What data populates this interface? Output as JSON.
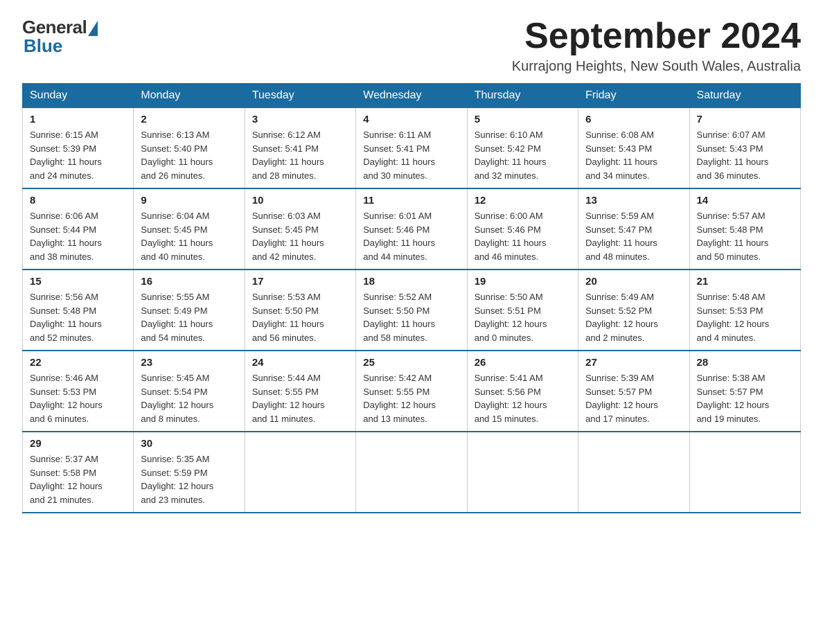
{
  "logo": {
    "general": "General",
    "blue": "Blue"
  },
  "title": "September 2024",
  "subtitle": "Kurrajong Heights, New South Wales, Australia",
  "days_of_week": [
    "Sunday",
    "Monday",
    "Tuesday",
    "Wednesday",
    "Thursday",
    "Friday",
    "Saturday"
  ],
  "weeks": [
    [
      {
        "day": "1",
        "sunrise": "6:15 AM",
        "sunset": "5:39 PM",
        "daylight": "11 hours and 24 minutes."
      },
      {
        "day": "2",
        "sunrise": "6:13 AM",
        "sunset": "5:40 PM",
        "daylight": "11 hours and 26 minutes."
      },
      {
        "day": "3",
        "sunrise": "6:12 AM",
        "sunset": "5:41 PM",
        "daylight": "11 hours and 28 minutes."
      },
      {
        "day": "4",
        "sunrise": "6:11 AM",
        "sunset": "5:41 PM",
        "daylight": "11 hours and 30 minutes."
      },
      {
        "day": "5",
        "sunrise": "6:10 AM",
        "sunset": "5:42 PM",
        "daylight": "11 hours and 32 minutes."
      },
      {
        "day": "6",
        "sunrise": "6:08 AM",
        "sunset": "5:43 PM",
        "daylight": "11 hours and 34 minutes."
      },
      {
        "day": "7",
        "sunrise": "6:07 AM",
        "sunset": "5:43 PM",
        "daylight": "11 hours and 36 minutes."
      }
    ],
    [
      {
        "day": "8",
        "sunrise": "6:06 AM",
        "sunset": "5:44 PM",
        "daylight": "11 hours and 38 minutes."
      },
      {
        "day": "9",
        "sunrise": "6:04 AM",
        "sunset": "5:45 PM",
        "daylight": "11 hours and 40 minutes."
      },
      {
        "day": "10",
        "sunrise": "6:03 AM",
        "sunset": "5:45 PM",
        "daylight": "11 hours and 42 minutes."
      },
      {
        "day": "11",
        "sunrise": "6:01 AM",
        "sunset": "5:46 PM",
        "daylight": "11 hours and 44 minutes."
      },
      {
        "day": "12",
        "sunrise": "6:00 AM",
        "sunset": "5:46 PM",
        "daylight": "11 hours and 46 minutes."
      },
      {
        "day": "13",
        "sunrise": "5:59 AM",
        "sunset": "5:47 PM",
        "daylight": "11 hours and 48 minutes."
      },
      {
        "day": "14",
        "sunrise": "5:57 AM",
        "sunset": "5:48 PM",
        "daylight": "11 hours and 50 minutes."
      }
    ],
    [
      {
        "day": "15",
        "sunrise": "5:56 AM",
        "sunset": "5:48 PM",
        "daylight": "11 hours and 52 minutes."
      },
      {
        "day": "16",
        "sunrise": "5:55 AM",
        "sunset": "5:49 PM",
        "daylight": "11 hours and 54 minutes."
      },
      {
        "day": "17",
        "sunrise": "5:53 AM",
        "sunset": "5:50 PM",
        "daylight": "11 hours and 56 minutes."
      },
      {
        "day": "18",
        "sunrise": "5:52 AM",
        "sunset": "5:50 PM",
        "daylight": "11 hours and 58 minutes."
      },
      {
        "day": "19",
        "sunrise": "5:50 AM",
        "sunset": "5:51 PM",
        "daylight": "12 hours and 0 minutes."
      },
      {
        "day": "20",
        "sunrise": "5:49 AM",
        "sunset": "5:52 PM",
        "daylight": "12 hours and 2 minutes."
      },
      {
        "day": "21",
        "sunrise": "5:48 AM",
        "sunset": "5:53 PM",
        "daylight": "12 hours and 4 minutes."
      }
    ],
    [
      {
        "day": "22",
        "sunrise": "5:46 AM",
        "sunset": "5:53 PM",
        "daylight": "12 hours and 6 minutes."
      },
      {
        "day": "23",
        "sunrise": "5:45 AM",
        "sunset": "5:54 PM",
        "daylight": "12 hours and 8 minutes."
      },
      {
        "day": "24",
        "sunrise": "5:44 AM",
        "sunset": "5:55 PM",
        "daylight": "12 hours and 11 minutes."
      },
      {
        "day": "25",
        "sunrise": "5:42 AM",
        "sunset": "5:55 PM",
        "daylight": "12 hours and 13 minutes."
      },
      {
        "day": "26",
        "sunrise": "5:41 AM",
        "sunset": "5:56 PM",
        "daylight": "12 hours and 15 minutes."
      },
      {
        "day": "27",
        "sunrise": "5:39 AM",
        "sunset": "5:57 PM",
        "daylight": "12 hours and 17 minutes."
      },
      {
        "day": "28",
        "sunrise": "5:38 AM",
        "sunset": "5:57 PM",
        "daylight": "12 hours and 19 minutes."
      }
    ],
    [
      {
        "day": "29",
        "sunrise": "5:37 AM",
        "sunset": "5:58 PM",
        "daylight": "12 hours and 21 minutes."
      },
      {
        "day": "30",
        "sunrise": "5:35 AM",
        "sunset": "5:59 PM",
        "daylight": "12 hours and 23 minutes."
      },
      null,
      null,
      null,
      null,
      null
    ]
  ],
  "labels": {
    "sunrise": "Sunrise:",
    "sunset": "Sunset:",
    "daylight": "Daylight:"
  }
}
